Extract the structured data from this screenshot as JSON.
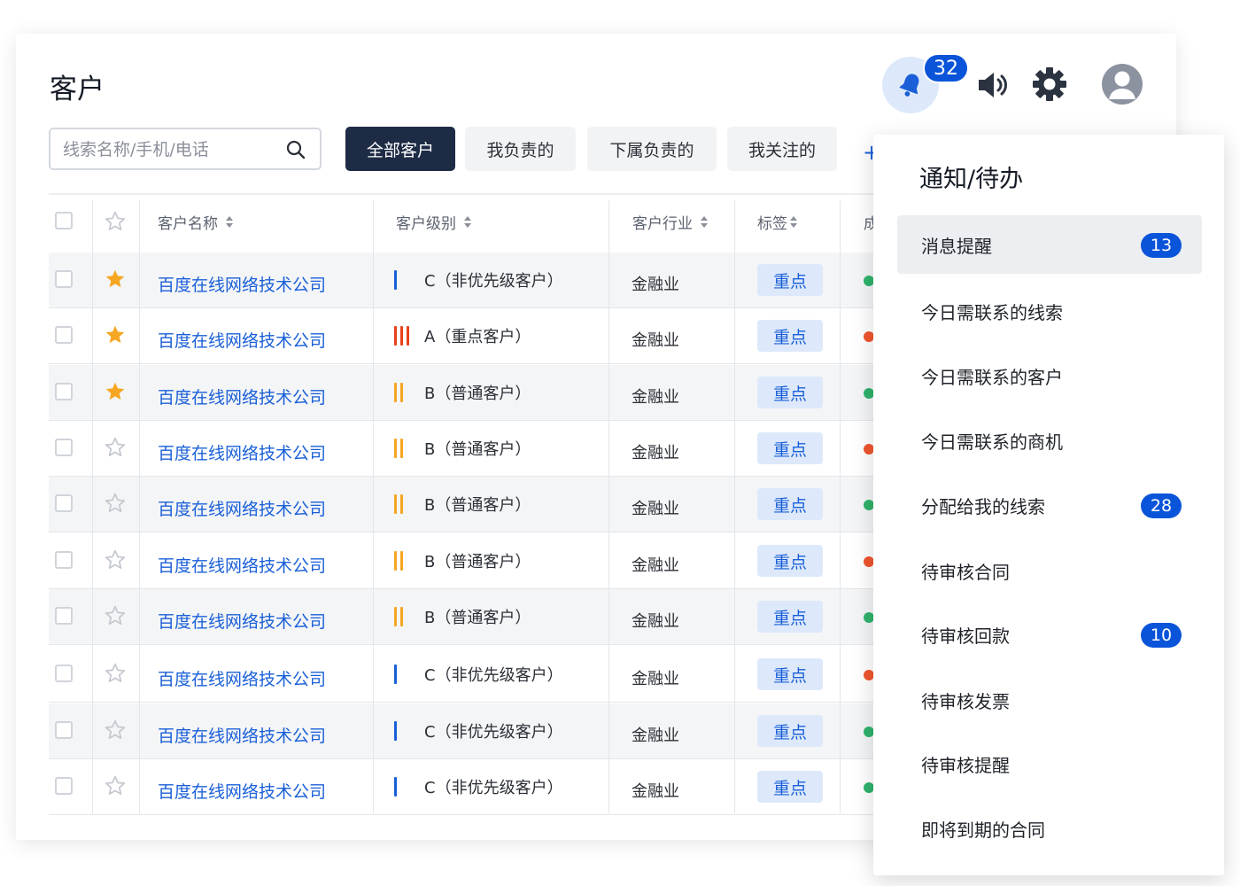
{
  "page": {
    "title": "客户"
  },
  "header": {
    "notification_count": "32",
    "icons": [
      "bell-icon",
      "speaker-icon",
      "gear-icon",
      "user-avatar-icon"
    ]
  },
  "search": {
    "placeholder": "线索名称/手机/电话",
    "value": ""
  },
  "filter_tabs": [
    {
      "label": "全部客户",
      "active": true
    },
    {
      "label": "我负责的",
      "active": false
    },
    {
      "label": "下属负责的",
      "active": false
    },
    {
      "label": "我关注的",
      "active": false
    }
  ],
  "add_icon": "+",
  "table": {
    "columns": [
      "客户名称",
      "客户级别",
      "客户行业",
      "标签",
      "成"
    ],
    "rows": [
      {
        "name": "百度在线网络技术公司",
        "starred": true,
        "level": "C（非优先级客户）",
        "level_bars": 1,
        "industry": "金融业",
        "tag": "重点",
        "status": "green"
      },
      {
        "name": "百度在线网络技术公司",
        "starred": true,
        "level": "A（重点客户）",
        "level_bars": 3,
        "industry": "金融业",
        "tag": "重点",
        "status": "red"
      },
      {
        "name": "百度在线网络技术公司",
        "starred": true,
        "level": "B（普通客户）",
        "level_bars": 2,
        "industry": "金融业",
        "tag": "重点",
        "status": "green"
      },
      {
        "name": "百度在线网络技术公司",
        "starred": false,
        "level": "B（普通客户）",
        "level_bars": 2,
        "industry": "金融业",
        "tag": "重点",
        "status": "red"
      },
      {
        "name": "百度在线网络技术公司",
        "starred": false,
        "level": "B（普通客户）",
        "level_bars": 2,
        "industry": "金融业",
        "tag": "重点",
        "status": "green"
      },
      {
        "name": "百度在线网络技术公司",
        "starred": false,
        "level": "B（普通客户）",
        "level_bars": 2,
        "industry": "金融业",
        "tag": "重点",
        "status": "red"
      },
      {
        "name": "百度在线网络技术公司",
        "starred": false,
        "level": "B（普通客户）",
        "level_bars": 2,
        "industry": "金融业",
        "tag": "重点",
        "status": "green"
      },
      {
        "name": "百度在线网络技术公司",
        "starred": false,
        "level": "C（非优先级客户）",
        "level_bars": 1,
        "industry": "金融业",
        "tag": "重点",
        "status": "red"
      },
      {
        "name": "百度在线网络技术公司",
        "starred": false,
        "level": "C（非优先级客户）",
        "level_bars": 1,
        "industry": "金融业",
        "tag": "重点",
        "status": "green"
      },
      {
        "name": "百度在线网络技术公司",
        "starred": false,
        "level": "C（非优先级客户）",
        "level_bars": 1,
        "industry": "金融业",
        "tag": "重点",
        "status": "green"
      }
    ]
  },
  "dropdown": {
    "title": "通知/待办",
    "items": [
      {
        "label": "消息提醒",
        "count": "13",
        "highlighted": true
      },
      {
        "label": "今日需联系的线索",
        "count": null
      },
      {
        "label": "今日需联系的客户",
        "count": null
      },
      {
        "label": "今日需联系的商机",
        "count": null
      },
      {
        "label": "分配给我的线索",
        "count": "28"
      },
      {
        "label": "待审核合同",
        "count": null
      },
      {
        "label": "待审核回款",
        "count": "10"
      },
      {
        "label": "待审核发票",
        "count": null
      },
      {
        "label": "待审核提醒",
        "count": null
      },
      {
        "label": "即将到期的合同",
        "count": null
      }
    ]
  },
  "colors": {
    "accent": "#1a5fd8",
    "badge": "#0a54d9",
    "active_tab": "#1e2b45",
    "star": "#f5a623",
    "level_c": "#1a5fd8",
    "level_b": "#f5a623",
    "level_a": "#e8401c",
    "status_green": "#2fb36b",
    "status_red": "#f0562f"
  }
}
